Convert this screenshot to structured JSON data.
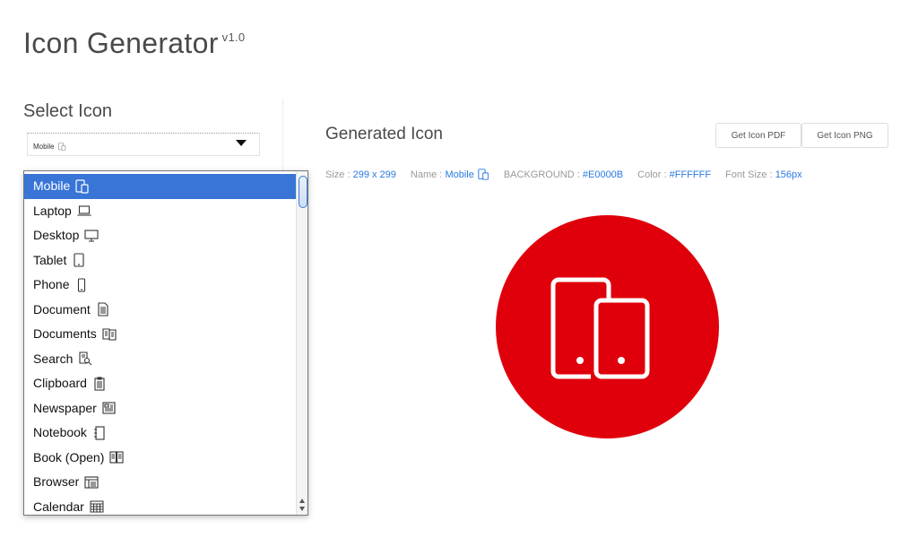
{
  "header": {
    "title": "Icon Generator",
    "version": "v1.0"
  },
  "selector": {
    "heading": "Select Icon",
    "selected": "Mobile",
    "options": [
      {
        "label": "Mobile",
        "icon": "mobile-icon",
        "active": true
      },
      {
        "label": "Laptop",
        "icon": "laptop-icon"
      },
      {
        "label": "Desktop",
        "icon": "desktop-icon"
      },
      {
        "label": "Tablet",
        "icon": "tablet-icon"
      },
      {
        "label": "Phone",
        "icon": "phone-icon"
      },
      {
        "label": "Document",
        "icon": "document-icon"
      },
      {
        "label": "Documents",
        "icon": "documents-icon"
      },
      {
        "label": "Search",
        "icon": "search-document-icon"
      },
      {
        "label": "Clipboard",
        "icon": "clipboard-icon"
      },
      {
        "label": "Newspaper",
        "icon": "newspaper-icon"
      },
      {
        "label": "Notebook",
        "icon": "notebook-icon"
      },
      {
        "label": "Book (Open)",
        "icon": "book-open-icon"
      },
      {
        "label": "Browser",
        "icon": "browser-icon"
      },
      {
        "label": "Calendar",
        "icon": "calendar-icon"
      }
    ]
  },
  "generated": {
    "heading": "Generated Icon",
    "pdf_button": "Get Icon PDF",
    "png_button": "Get Icon PNG",
    "size_label": "Size :",
    "size_value": "299 x 299",
    "name_label": "Name  :",
    "name_value": "Mobile",
    "background_label": "BACKGROUND :",
    "background_value": "#E0000B",
    "color_label": "Color :",
    "color_value": "#FFFFFF",
    "font_size_label": "Font Size :",
    "font_size_value": "156px"
  },
  "colors": {
    "background": "#E0000B",
    "foreground": "#FFFFFF",
    "accent": "#3875d7",
    "link": "#2a7ae2"
  }
}
